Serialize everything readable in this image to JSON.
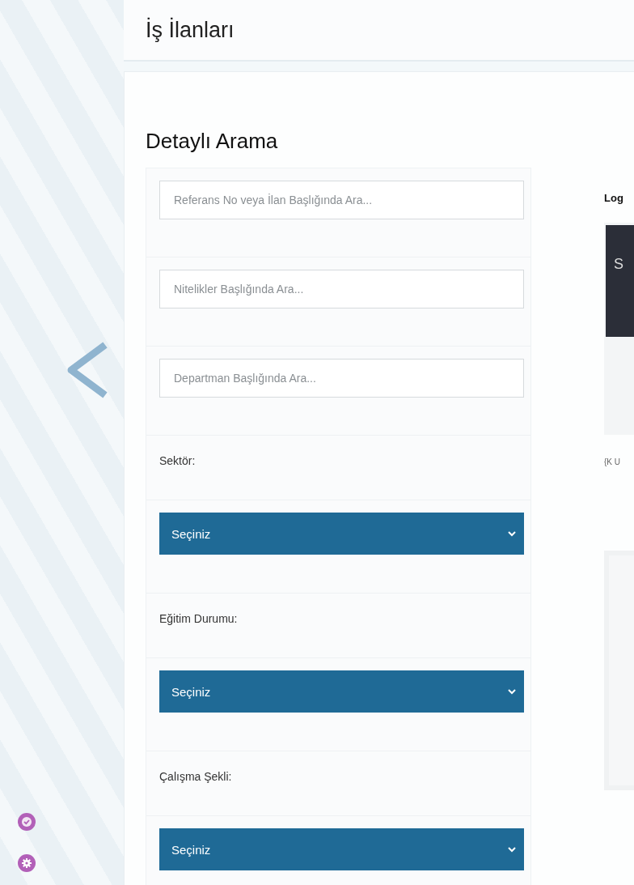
{
  "page": {
    "title": "İş İlanları"
  },
  "search": {
    "title": "Detaylı Arama",
    "filters": [
      {
        "kind": "text",
        "placeholder": "Referans No veya İlan Başlığında Ara..."
      },
      {
        "kind": "text",
        "placeholder": "Nitelikler Başlığında Ara..."
      },
      {
        "kind": "text",
        "placeholder": "Departman Başlığında Ara..."
      },
      {
        "kind": "select",
        "label": "Sektör:",
        "value": "Seçiniz"
      },
      {
        "kind": "select",
        "label": "Eğitim Durumu:",
        "value": "Seçiniz"
      },
      {
        "kind": "select",
        "label": "Çalışma Şekli:",
        "value": "Seçiniz"
      }
    ]
  },
  "preview": {
    "heading": "Log",
    "tile_text": "S",
    "caption": "{K U"
  }
}
